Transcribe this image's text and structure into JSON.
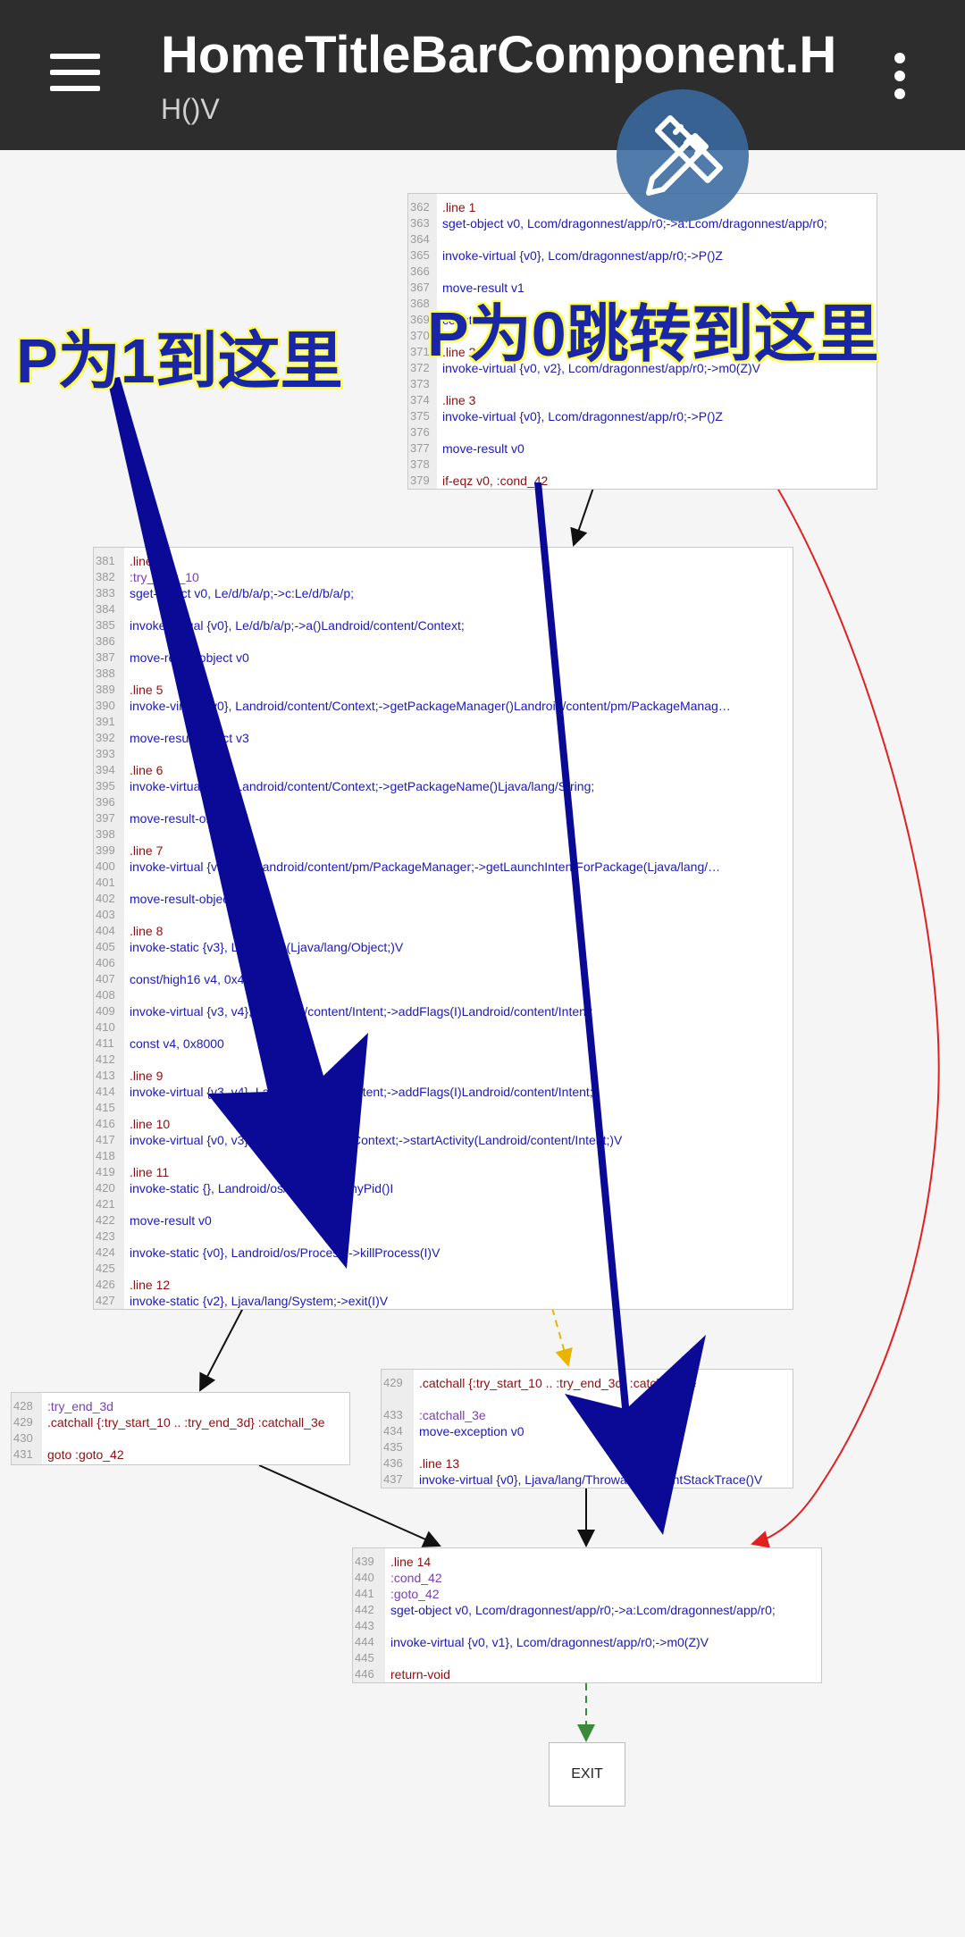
{
  "appbar": {
    "title": "HomeTitleBarComponent.H",
    "subtitle": "H()V",
    "menu_icon": "hamburger-menu-icon",
    "overflow_icon": "more-vert-icon"
  },
  "fab": {
    "icon": "pencil-ruler-icon"
  },
  "annotations": {
    "p1": "P为1到这里",
    "p0": "P为0跳转到这里"
  },
  "colors": {
    "appbar_bg": "#2d2d2d",
    "annotation_text": "#1a26a8",
    "annotation_outline": "#ffff40",
    "arrow": "#0a0a96",
    "edge_normal": "#111111",
    "edge_branch": "#e02020",
    "edge_exception": "#e8b400",
    "edge_exit": "#3a8a3a"
  },
  "nodes": [
    {
      "id": "block-362",
      "lines": [
        {
          "n": "362",
          "t": ".line 1"
        },
        {
          "n": "363",
          "t": "sget-object v0, Lcom/dragonnest/app/r0;->a:Lcom/dragonnest/app/r0;"
        },
        {
          "n": "364",
          "t": ""
        },
        {
          "n": "365",
          "t": "invoke-virtual {v0}, Lcom/dragonnest/app/r0;->P()Z"
        },
        {
          "n": "366",
          "t": ""
        },
        {
          "n": "367",
          "t": "move-result v1"
        },
        {
          "n": "368",
          "t": ""
        },
        {
          "n": "369",
          "t": "const/4 v2, 0x"
        },
        {
          "n": "370",
          "t": ""
        },
        {
          "n": "371",
          "t": ".line 2"
        },
        {
          "n": "372",
          "t": "invoke-virtual {v0, v2}, Lcom/dragonnest/app/r0;->m0(Z)V"
        },
        {
          "n": "373",
          "t": ""
        },
        {
          "n": "374",
          "t": ".line 3"
        },
        {
          "n": "375",
          "t": "invoke-virtual {v0}, Lcom/dragonnest/app/r0;->P()Z"
        },
        {
          "n": "376",
          "t": ""
        },
        {
          "n": "377",
          "t": "move-result v0"
        },
        {
          "n": "378",
          "t": ""
        },
        {
          "n": "379",
          "t": "if-eqz v0, :cond_42"
        }
      ]
    },
    {
      "id": "block-381",
      "lines": [
        {
          "n": "381",
          "t": ".line 4"
        },
        {
          "n": "382",
          "t": ":try_start_10"
        },
        {
          "n": "383",
          "t": "sget-object v0, Le/d/b/a/p;->c:Le/d/b/a/p;"
        },
        {
          "n": "384",
          "t": ""
        },
        {
          "n": "385",
          "t": "invoke-virtual {v0}, Le/d/b/a/p;->a()Landroid/content/Context;"
        },
        {
          "n": "386",
          "t": ""
        },
        {
          "n": "387",
          "t": "move-result-object v0"
        },
        {
          "n": "388",
          "t": ""
        },
        {
          "n": "389",
          "t": ".line 5"
        },
        {
          "n": "390",
          "t": "invoke-virtual {v0}, Landroid/content/Context;->getPackageManager()Landroid/content/pm/PackageManag…"
        },
        {
          "n": "391",
          "t": ""
        },
        {
          "n": "392",
          "t": "move-result-object v3"
        },
        {
          "n": "393",
          "t": ""
        },
        {
          "n": "394",
          "t": ".line 6"
        },
        {
          "n": "395",
          "t": "invoke-virtual {v0}, Landroid/content/Context;->getPackageName()Ljava/lang/String;"
        },
        {
          "n": "396",
          "t": ""
        },
        {
          "n": "397",
          "t": "move-result-object v4"
        },
        {
          "n": "398",
          "t": ""
        },
        {
          "n": "399",
          "t": ".line 7"
        },
        {
          "n": "400",
          "t": "invoke-virtual {v3, v4}, Landroid/content/pm/PackageManager;->getLaunchIntentForPackage(Ljava/lang/…"
        },
        {
          "n": "401",
          "t": ""
        },
        {
          "n": "402",
          "t": "move-result-object v3"
        },
        {
          "n": "403",
          "t": ""
        },
        {
          "n": "404",
          "t": ".line 8"
        },
        {
          "n": "405",
          "t": "invoke-static {v3}, Le/d/k;->c(Ljava/lang/Object;)V"
        },
        {
          "n": "406",
          "t": ""
        },
        {
          "n": "407",
          "t": "const/high16 v4, 0x4000000"
        },
        {
          "n": "408",
          "t": ""
        },
        {
          "n": "409",
          "t": "invoke-virtual {v3, v4}, Landroid/content/Intent;->addFlags(I)Landroid/content/Intent;"
        },
        {
          "n": "410",
          "t": ""
        },
        {
          "n": "411",
          "t": "const v4, 0x8000"
        },
        {
          "n": "412",
          "t": ""
        },
        {
          "n": "413",
          "t": ".line 9"
        },
        {
          "n": "414",
          "t": "invoke-virtual {v3, v4}, Landroid/content/Intent;->addFlags(I)Landroid/content/Intent;"
        },
        {
          "n": "415",
          "t": ""
        },
        {
          "n": "416",
          "t": ".line 10"
        },
        {
          "n": "417",
          "t": "invoke-virtual {v0, v3}, Landroid/content/Context;->startActivity(Landroid/content/Intent;)V"
        },
        {
          "n": "418",
          "t": ""
        },
        {
          "n": "419",
          "t": ".line 11"
        },
        {
          "n": "420",
          "t": "invoke-static {}, Landroid/os/Process;->myPid()I"
        },
        {
          "n": "421",
          "t": ""
        },
        {
          "n": "422",
          "t": "move-result v0"
        },
        {
          "n": "423",
          "t": ""
        },
        {
          "n": "424",
          "t": "invoke-static {v0}, Landroid/os/Process;->killProcess(I)V"
        },
        {
          "n": "425",
          "t": ""
        },
        {
          "n": "426",
          "t": ".line 12"
        },
        {
          "n": "427",
          "t": "invoke-static {v2}, Ljava/lang/System;->exit(I)V"
        }
      ]
    },
    {
      "id": "block-428",
      "lines": [
        {
          "n": "428",
          "t": ":try_end_3d"
        },
        {
          "n": "429",
          "t": ".catchall {:try_start_10 .. :try_end_3d} :catchall_3e"
        },
        {
          "n": "430",
          "t": ""
        },
        {
          "n": "431",
          "t": "goto :goto_42"
        }
      ]
    },
    {
      "id": "block-catch",
      "lines": [
        {
          "n": "429",
          "t": ".catchall {:try_start_10 .. :try_end_3d} :catchall_3e"
        },
        {
          "n": "",
          "t": ""
        },
        {
          "n": "433",
          "t": ":catchall_3e"
        },
        {
          "n": "434",
          "t": "move-exception v0"
        },
        {
          "n": "435",
          "t": ""
        },
        {
          "n": "436",
          "t": ".line 13"
        },
        {
          "n": "437",
          "t": "invoke-virtual {v0}, Ljava/lang/Throwable;->printStackTrace()V"
        }
      ]
    },
    {
      "id": "block-439",
      "lines": [
        {
          "n": "439",
          "t": ".line 14"
        },
        {
          "n": "440",
          "t": ":cond_42"
        },
        {
          "n": "441",
          "t": ":goto_42"
        },
        {
          "n": "442",
          "t": "sget-object v0, Lcom/dragonnest/app/r0;->a:Lcom/dragonnest/app/r0;"
        },
        {
          "n": "443",
          "t": ""
        },
        {
          "n": "444",
          "t": "invoke-virtual {v0, v1}, Lcom/dragonnest/app/r0;->m0(Z)V"
        },
        {
          "n": "445",
          "t": ""
        },
        {
          "n": "446",
          "t": "return-void"
        }
      ]
    }
  ],
  "exit_label": "EXIT"
}
